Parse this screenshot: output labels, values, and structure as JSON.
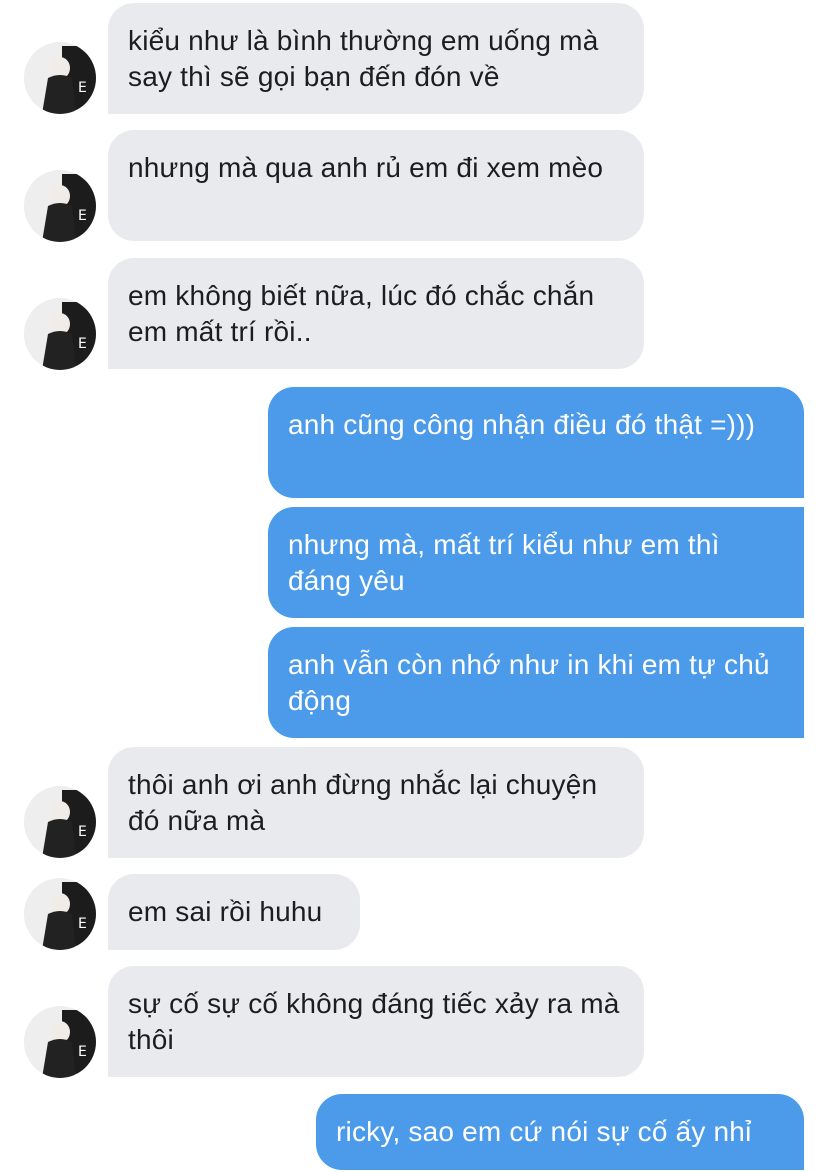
{
  "conversation": {
    "messages": [
      {
        "sender": "other",
        "text": "kiểu như là bình thường em uống mà say thì sẽ gọi bạn đến đón về"
      },
      {
        "sender": "other",
        "text": "nhưng mà qua anh rủ em đi xem mèo"
      },
      {
        "sender": "other",
        "text": "em không biết nữa, lúc đó chắc chắn em mất trí rồi.."
      },
      {
        "sender": "me",
        "text": "anh cũng công nhận điều đó thật =)))"
      },
      {
        "sender": "me",
        "text": "nhưng mà, mất trí kiểu như em thì đáng yêu"
      },
      {
        "sender": "me",
        "text": "anh vẫn còn nhớ như in khi em tự chủ động"
      },
      {
        "sender": "other",
        "text": "thôi anh ơi anh đừng nhắc lại chuyện đó nữa mà"
      },
      {
        "sender": "other",
        "text": "em sai rồi huhu"
      },
      {
        "sender": "other",
        "text": "sự cố sự cố không đáng tiếc xảy ra mà thôi"
      },
      {
        "sender": "me",
        "text": "ricky, sao em cứ nói sự cố ấy nhỉ"
      }
    ]
  },
  "colors": {
    "incoming_bubble": "#e8eaee",
    "outgoing_bubble": "#4b9bea",
    "incoming_text": "#1b1d21",
    "outgoing_text": "#ffffff"
  },
  "icons": {
    "avatar": "profile-photo-icon"
  }
}
